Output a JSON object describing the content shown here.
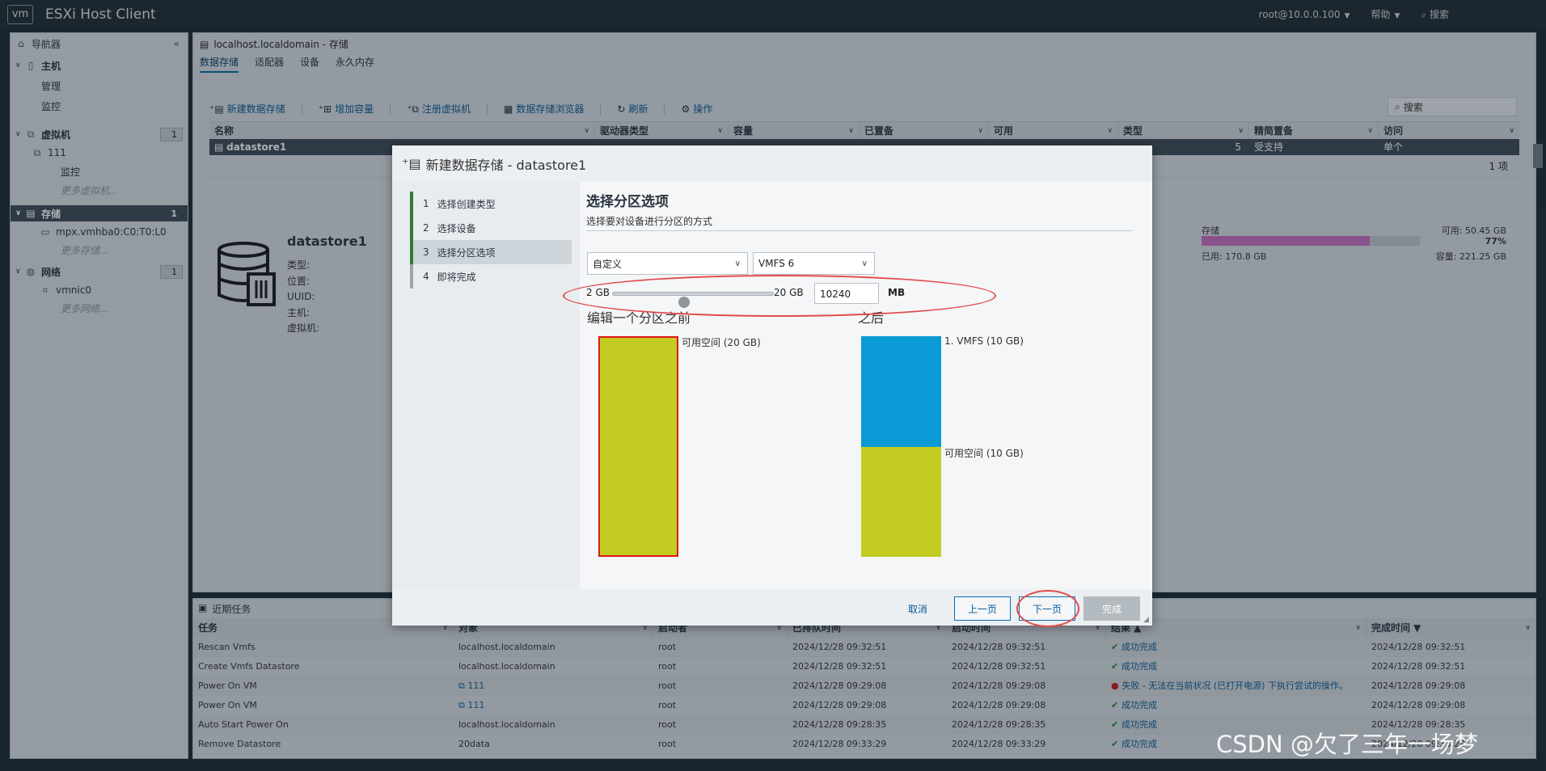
{
  "topbar": {
    "logo": "vm",
    "title": "ESXi Host Client",
    "user": "root@10.0.0.100",
    "help": "帮助",
    "search": "搜索"
  },
  "sidebar": {
    "navigator": "导航器",
    "host": "主机",
    "manage": "管理",
    "monitor": "监控",
    "vms": "虚拟机",
    "vms_count": "1",
    "vm_111": "111",
    "vm_monitor": "监控",
    "more_vms": "更多虚拟机...",
    "storage": "存储",
    "storage_count": "1",
    "storage_dev": "mpx.vmhba0:C0:T0:L0",
    "more_storage": "更多存储...",
    "network": "网络",
    "network_count": "1",
    "vmnic": "vmnic0",
    "more_network": "更多网络..."
  },
  "main": {
    "breadcrumb": "localhost.localdomain - 存储",
    "tabs": [
      "数据存储",
      "适配器",
      "设备",
      "永久内存"
    ],
    "toolbar": {
      "new_ds": "新建数据存储",
      "add_capacity": "增加容量",
      "register_vm": "注册虚拟机",
      "ds_browser": "数据存储浏览器",
      "refresh": "刷新",
      "actions": "操作",
      "search": "搜索"
    },
    "columns": [
      "名称",
      "驱动器类型",
      "容量",
      "已置备",
      "可用",
      "类型",
      "精简置备",
      "访问"
    ],
    "row": {
      "name": "datastore1",
      "type_tail": "5",
      "thin": "受支持",
      "access": "单个"
    },
    "count": "1 项",
    "detail": {
      "name": "datastore1",
      "props": [
        "类型:",
        "位置:",
        "UUID:",
        "主机:",
        "虚拟机:"
      ]
    },
    "storage_summary": {
      "label": "存储",
      "free": "可用: 50.45 GB",
      "percent": "77%",
      "used": "已用: 170.8 GB",
      "capacity": "容量: 221.25 GB",
      "used_fraction": 0.77
    }
  },
  "tasks": {
    "title": "近期任务",
    "columns": [
      "任务",
      "对象",
      "启动者",
      "已排队时间",
      "启动时间",
      "结果 ▲",
      "完成时间 ▼"
    ],
    "rows": [
      {
        "task": "Rescan Vmfs",
        "object": "localhost.localdomain",
        "by": "root",
        "queued": "2024/12/28 09:32:51",
        "start": "2024/12/28 09:32:51",
        "result": "成功完成",
        "done": "2024/12/28 09:32:51"
      },
      {
        "task": "Create Vmfs Datastore",
        "object": "localhost.localdomain",
        "by": "root",
        "queued": "2024/12/28 09:32:51",
        "start": "2024/12/28 09:32:51",
        "result": "成功完成",
        "done": "2024/12/28 09:32:51"
      },
      {
        "task": "Power On VM",
        "object": "111",
        "by": "root",
        "queued": "2024/12/28 09:29:08",
        "start": "2024/12/28 09:29:08",
        "result": "失败 - 无法在当前状况 (已打开电源) 下执行尝试的操作。",
        "done": "2024/12/28 09:29:08"
      },
      {
        "task": "Power On VM",
        "object": "111",
        "by": "root",
        "queued": "2024/12/28 09:29:08",
        "start": "2024/12/28 09:29:08",
        "result": "成功完成",
        "done": "2024/12/28 09:29:08"
      },
      {
        "task": "Auto Start Power On",
        "object": "localhost.localdomain",
        "by": "root",
        "queued": "2024/12/28 09:28:35",
        "start": "2024/12/28 09:28:35",
        "result": "成功完成",
        "done": "2024/12/28 09:28:35"
      },
      {
        "task": "Remove Datastore",
        "object": "20data",
        "by": "root",
        "queued": "2024/12/28 09:33:29",
        "start": "2024/12/28 09:33:29",
        "result": "成功完成",
        "done": "2024/12/28 09:33:29"
      }
    ]
  },
  "dialog": {
    "title": "新建数据存储 - datastore1",
    "steps": [
      {
        "num": "1",
        "label": "选择创建类型"
      },
      {
        "num": "2",
        "label": "选择设备"
      },
      {
        "num": "3",
        "label": "选择分区选项"
      },
      {
        "num": "4",
        "label": "即将完成"
      }
    ],
    "section_title": "选择分区选项",
    "section_desc": "选择要对设备进行分区的方式",
    "partition_mode": "自定义",
    "fs_version": "VMFS 6",
    "slider_min": "2 GB",
    "slider_max": "20 GB",
    "slider_value": 0.44,
    "size_value": "10240",
    "size_unit": "MB",
    "before_label": "编辑一个分区之前",
    "after_label": "之后",
    "before_free": "可用空间  (20 GB)",
    "after_vmfs": "1. VMFS  (10 GB)",
    "after_free": "可用空间  (10 GB)",
    "cancel": "取消",
    "prev": "上一页",
    "next": "下一页",
    "finish": "完成"
  },
  "watermark": "CSDN @欠了三年一场梦"
}
